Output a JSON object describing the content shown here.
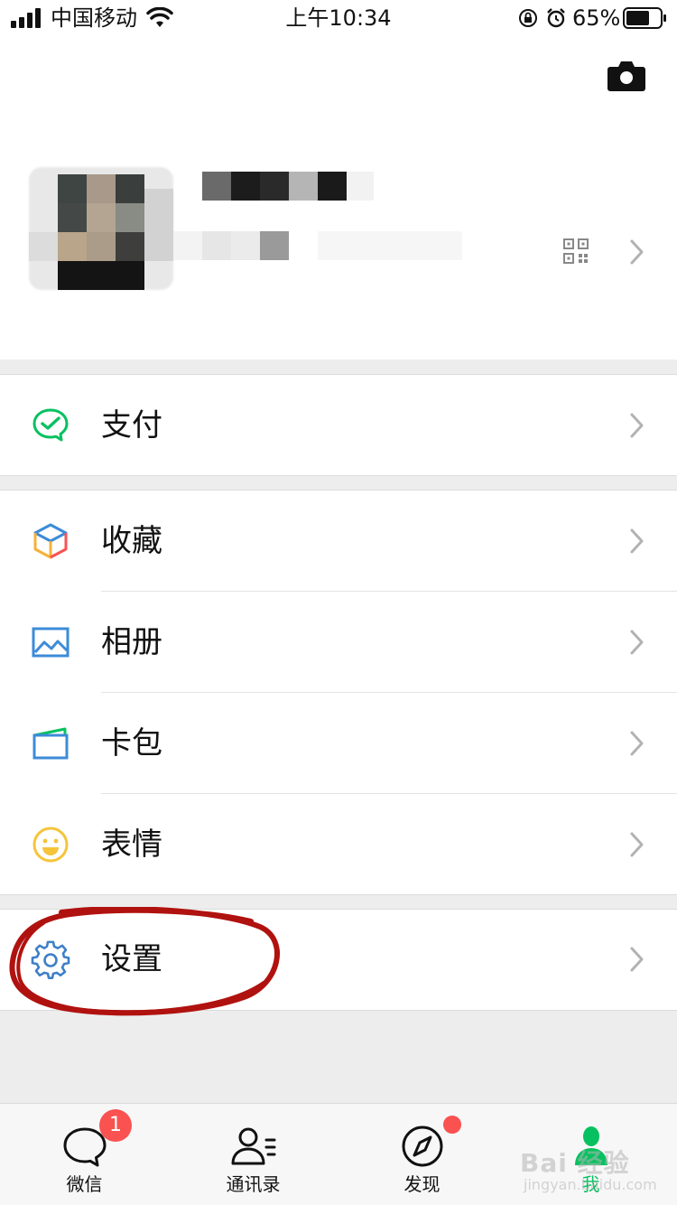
{
  "status_bar": {
    "carrier": "中国移动",
    "time": "上午10:34",
    "battery": "65%"
  },
  "profile": {
    "camera_icon": "camera-icon",
    "qr_icon": "qr-code-icon"
  },
  "menu_groups": [
    {
      "items": [
        {
          "label": "支付",
          "icon": "pay-icon",
          "color": "#07c160"
        }
      ]
    },
    {
      "items": [
        {
          "label": "收藏",
          "icon": "favorites-cube-icon",
          "color": "#f0a030"
        },
        {
          "label": "相册",
          "icon": "album-image-icon",
          "color": "#3d8bd8"
        },
        {
          "label": "卡包",
          "icon": "card-wallet-icon",
          "color": "#3d8bd8"
        },
        {
          "label": "表情",
          "icon": "sticker-smile-icon",
          "color": "#f5c43a"
        }
      ]
    },
    {
      "items": [
        {
          "label": "设置",
          "icon": "settings-gear-icon",
          "color": "#3d7fc8"
        }
      ]
    }
  ],
  "tab_bar": {
    "tabs": [
      {
        "label": "微信",
        "icon": "chat-bubble-icon",
        "badge": "1"
      },
      {
        "label": "通讯录",
        "icon": "contacts-icon"
      },
      {
        "label": "发现",
        "icon": "discover-compass-icon"
      },
      {
        "label": "我",
        "icon": "me-person-icon",
        "active": true
      }
    ]
  },
  "watermark": {
    "text": "Bai 经验",
    "sub": "jingyan.baidu.com"
  },
  "colors": {
    "accent": "#07c160",
    "badge": "#fa5151",
    "annotation": "#b0120f"
  }
}
